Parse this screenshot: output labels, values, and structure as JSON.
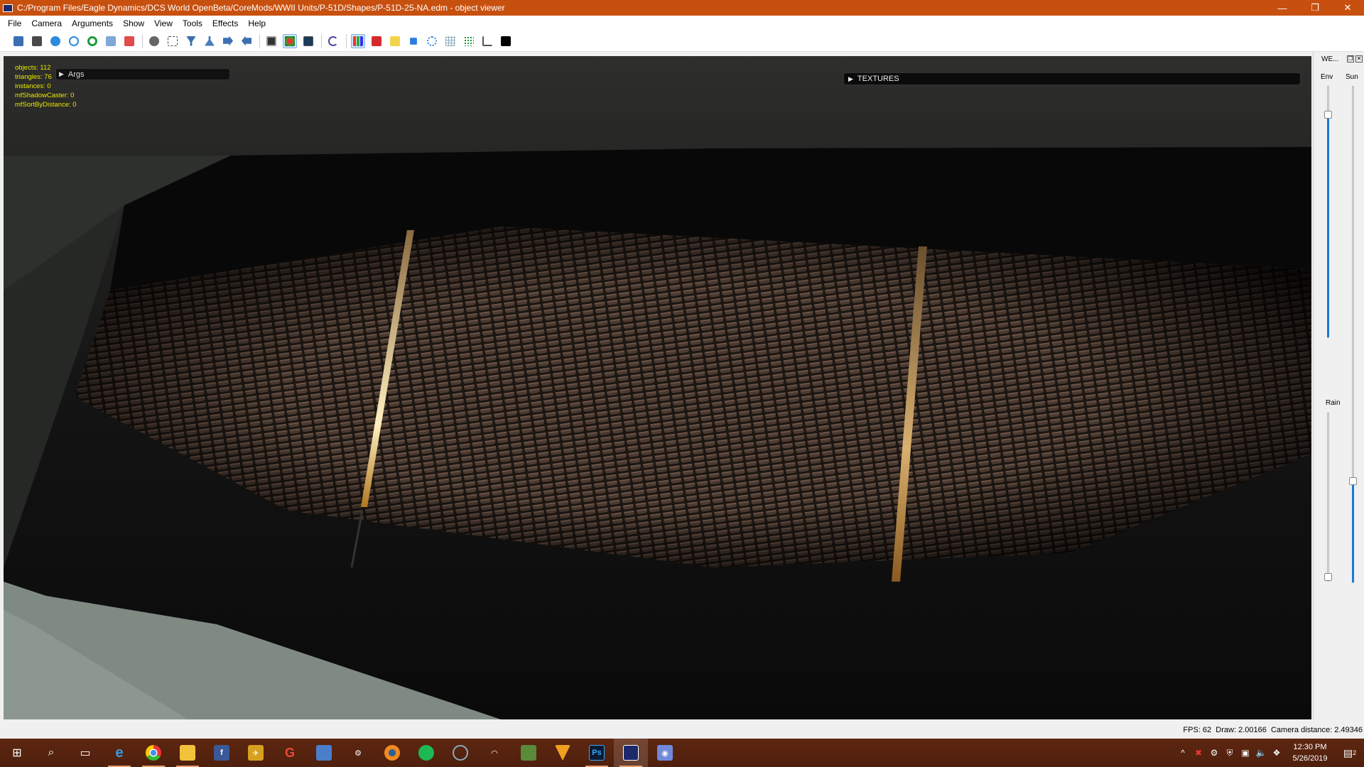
{
  "window": {
    "title": "C:/Program Files/Eagle Dynamics/DCS World OpenBeta/CoreMods/WWII Units/P-51D/Shapes/P-51D-25-NA.edm - object viewer",
    "minimize": "—",
    "maximize": "❐",
    "close": "✕"
  },
  "menu": [
    "File",
    "Camera",
    "Arguments",
    "Show",
    "View",
    "Tools",
    "Effects",
    "Help"
  ],
  "stats": {
    "objects": "objects: 112",
    "triangles": "triangles: 76",
    "instances": "instances: 0",
    "shadow_caster": "mfShadowCaster: 0",
    "sort_by_distance": "mfSortByDistance: 0"
  },
  "panels": {
    "args": "Args",
    "textures": "TEXTURES"
  },
  "weather": {
    "title": "WE...",
    "env": "Env",
    "sun": "Sun",
    "rain": "Rain",
    "env_level": 0.9,
    "rain_level": 0.0,
    "sun_level": 0.2
  },
  "status": {
    "fps": "FPS: 62",
    "draw": "Draw: 2.00166",
    "camera_distance": "Camera distance: 2.49346"
  },
  "taskbar": {
    "clock_time": "12:30 PM",
    "clock_date": "5/26/2019",
    "notifications": "2"
  }
}
